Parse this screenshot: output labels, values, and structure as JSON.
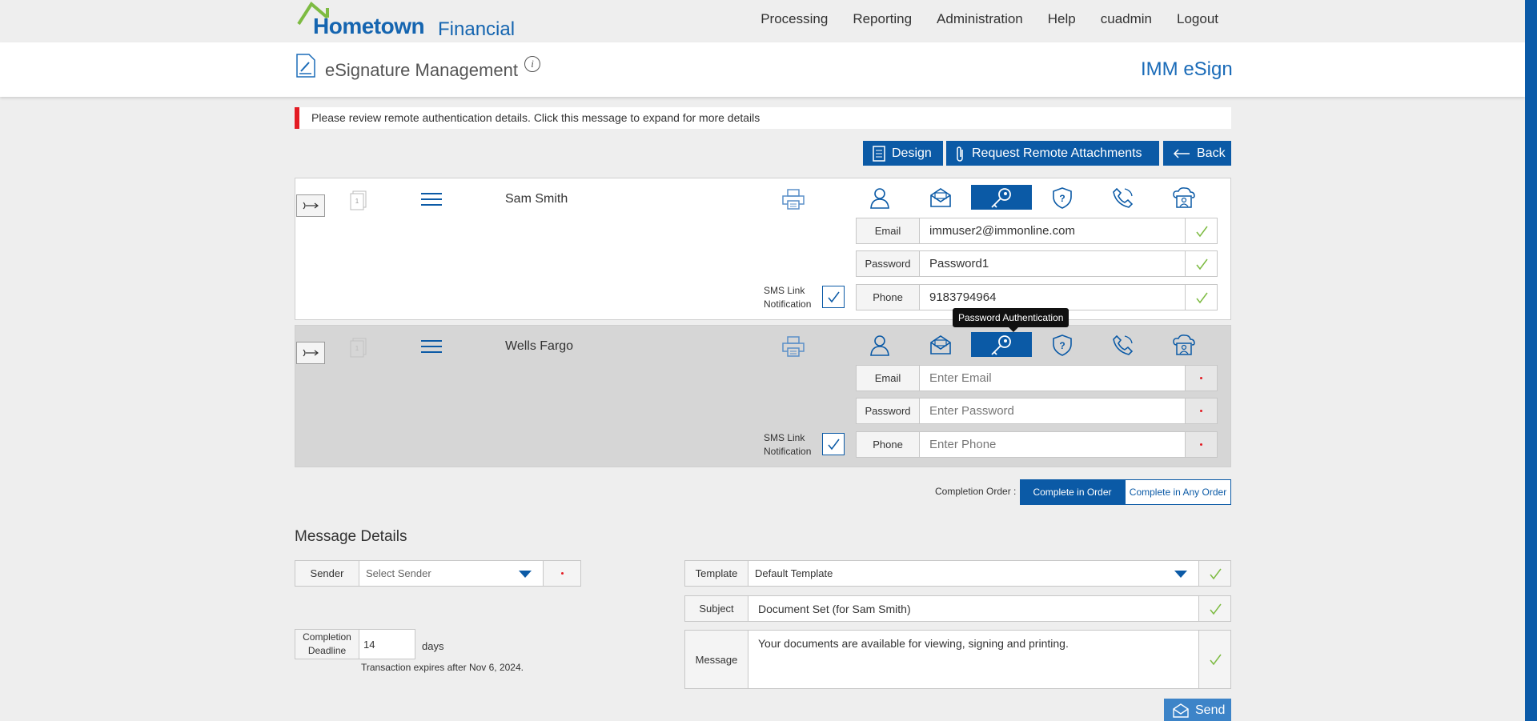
{
  "brand": {
    "name_bold": "Hometown",
    "name_light": "Financial"
  },
  "nav": [
    "Processing",
    "Reporting",
    "Administration",
    "Help",
    "cuadmin",
    "Logout"
  ],
  "header": {
    "title": "eSignature Management",
    "info": "i",
    "product": "IMM eSign"
  },
  "alert": "Please review remote authentication details. Click this message to expand for more details",
  "actions": {
    "design": "Design",
    "request": "Request Remote Attachments",
    "back": "Back"
  },
  "signers": [
    {
      "name": "Sam Smith",
      "doc_badge": "1",
      "sms_label_1": "SMS Link",
      "sms_label_2": "Notification",
      "fields": [
        {
          "label": "Email",
          "value": "immuser2@immonline.com",
          "placeholder": ""
        },
        {
          "label": "Password",
          "value": "Password1",
          "placeholder": ""
        },
        {
          "label": "Phone",
          "value": "9183794964",
          "placeholder": ""
        }
      ]
    },
    {
      "name": "Wells Fargo",
      "doc_badge": "1",
      "sms_label_1": "SMS Link",
      "sms_label_2": "Notification",
      "fields": [
        {
          "label": "Email",
          "value": "",
          "placeholder": "Enter Email"
        },
        {
          "label": "Password",
          "value": "",
          "placeholder": "Enter Password"
        },
        {
          "label": "Phone",
          "value": "",
          "placeholder": "Enter Phone"
        }
      ]
    }
  ],
  "auth_methods": [
    "user-icon",
    "email-icon",
    "password-key-icon",
    "question-shield-icon",
    "phone-icon",
    "id-card-icon"
  ],
  "tooltip": "Password Authentication",
  "completion_order": {
    "label": "Completion Order :",
    "in_order": "Complete in Order",
    "any_order": "Complete in Any Order"
  },
  "message_details": {
    "title": "Message Details",
    "sender_label": "Sender",
    "sender_placeholder": "Select Sender",
    "deadline_label_1": "Completion",
    "deadline_label_2": "Deadline",
    "deadline_value": "14",
    "days": "days",
    "expires": "Transaction expires after Nov 6, 2024.",
    "template_label": "Template",
    "template_value": "Default Template",
    "subject_label": "Subject",
    "subject_value": "Document Set (for Sam Smith)",
    "message_label": "Message",
    "message_value": "Your documents are available for viewing, signing and printing.",
    "send": "Send"
  },
  "colors": {
    "primary": "#0b5aa6",
    "alert": "#e31b23",
    "brand": "#1565b0",
    "logo_roof": "#7dbb42"
  }
}
